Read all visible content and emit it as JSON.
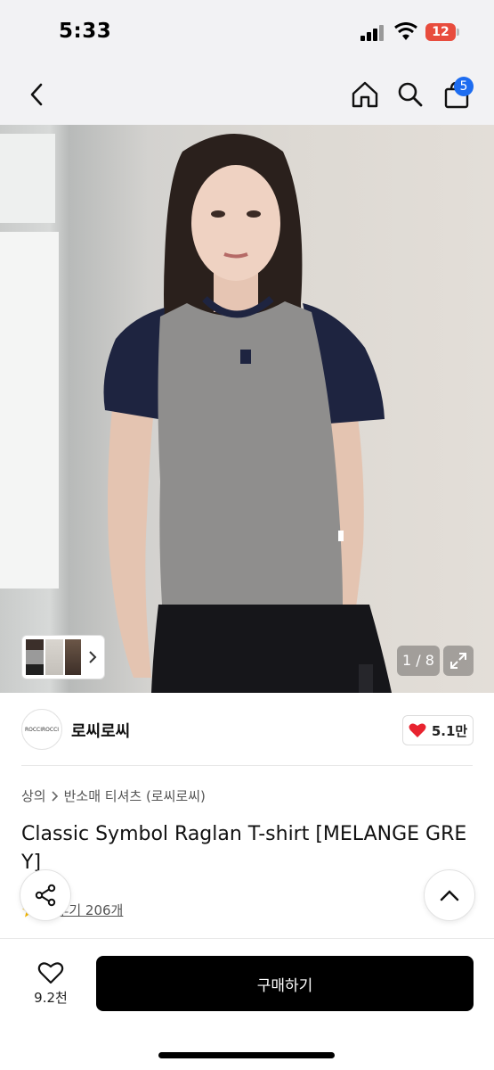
{
  "status_bar": {
    "time": "5:33",
    "battery": "12"
  },
  "header": {
    "cart_count": "5"
  },
  "gallery": {
    "counter": "1 / 8"
  },
  "brand": {
    "name": "로씨로씨",
    "logo_text": "ROCCIROCCI",
    "likes": "5.1만"
  },
  "breadcrumb": {
    "category": "상의",
    "sub_category": "반소매 티셔츠 (로씨로씨)"
  },
  "product": {
    "title": "Classic Symbol Raglan T-shirt [MELANGE GREY]",
    "rating_partial": "5",
    "reviews": "후기 206개"
  },
  "footer": {
    "wish_count": "9.2천",
    "buy_label": "구매하기"
  },
  "colors": {
    "accent_blue": "#1d6cf0",
    "heart_red": "#e8232f",
    "buy_button": "#000000"
  },
  "icons": [
    "back-icon",
    "home-icon",
    "search-icon",
    "cart-icon",
    "chevron-right-icon",
    "expand-icon",
    "heart-icon",
    "share-icon",
    "chevron-up-icon",
    "star-icon"
  ]
}
